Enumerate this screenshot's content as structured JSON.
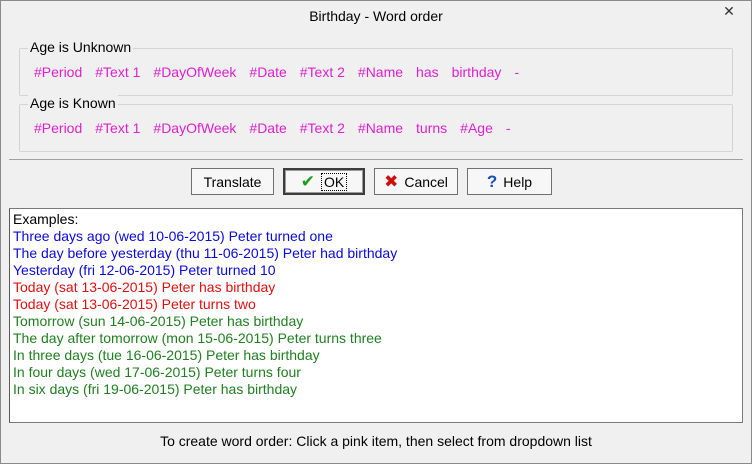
{
  "window": {
    "title": "Birthday - Word order",
    "close_glyph": "✕"
  },
  "groups": [
    {
      "label": "Age is Unknown",
      "tokens": [
        "#Period",
        "#Text 1",
        "#DayOfWeek",
        "#Date",
        "#Text 2",
        "#Name",
        "has",
        "birthday",
        "-"
      ]
    },
    {
      "label": "Age is Known",
      "tokens": [
        "#Period",
        "#Text 1",
        "#DayOfWeek",
        "#Date",
        "#Text 2",
        "#Name",
        "turns",
        "#Age",
        "-"
      ]
    }
  ],
  "buttons": {
    "translate": "Translate",
    "ok": "OK",
    "cancel": "Cancel",
    "help": "Help"
  },
  "icons": {
    "ok": "check-icon",
    "cancel": "x-icon",
    "help": "question-icon"
  },
  "colors": {
    "token": "#e020d0",
    "past": "#0a0adc",
    "today": "#e01010",
    "future": "#208020"
  },
  "examples": {
    "header": "Examples:",
    "lines": [
      {
        "text": "Three days ago (wed 10-06-2015) Peter turned one",
        "color": "#0a0adc"
      },
      {
        "text": "The day before yesterday (thu 11-06-2015) Peter had birthday",
        "color": "#0a0adc"
      },
      {
        "text": "Yesterday (fri 12-06-2015) Peter turned 10",
        "color": "#0a0adc"
      },
      {
        "text": "Today (sat 13-06-2015) Peter has birthday",
        "color": "#e01010"
      },
      {
        "text": "Today (sat 13-06-2015) Peter turns two",
        "color": "#e01010"
      },
      {
        "text": "Tomorrow (sun 14-06-2015) Peter has birthday",
        "color": "#208020"
      },
      {
        "text": "The day after tomorrow (mon 15-06-2015) Peter turns three",
        "color": "#208020"
      },
      {
        "text": "In three days (tue 16-06-2015) Peter has birthday",
        "color": "#208020"
      },
      {
        "text": "In four days (wed 17-06-2015) Peter turns four",
        "color": "#208020"
      },
      {
        "text": "In six days (fri 19-06-2015) Peter has birthday",
        "color": "#208020"
      }
    ]
  },
  "status": "To create word order: Click a pink item, then select from dropdown list"
}
